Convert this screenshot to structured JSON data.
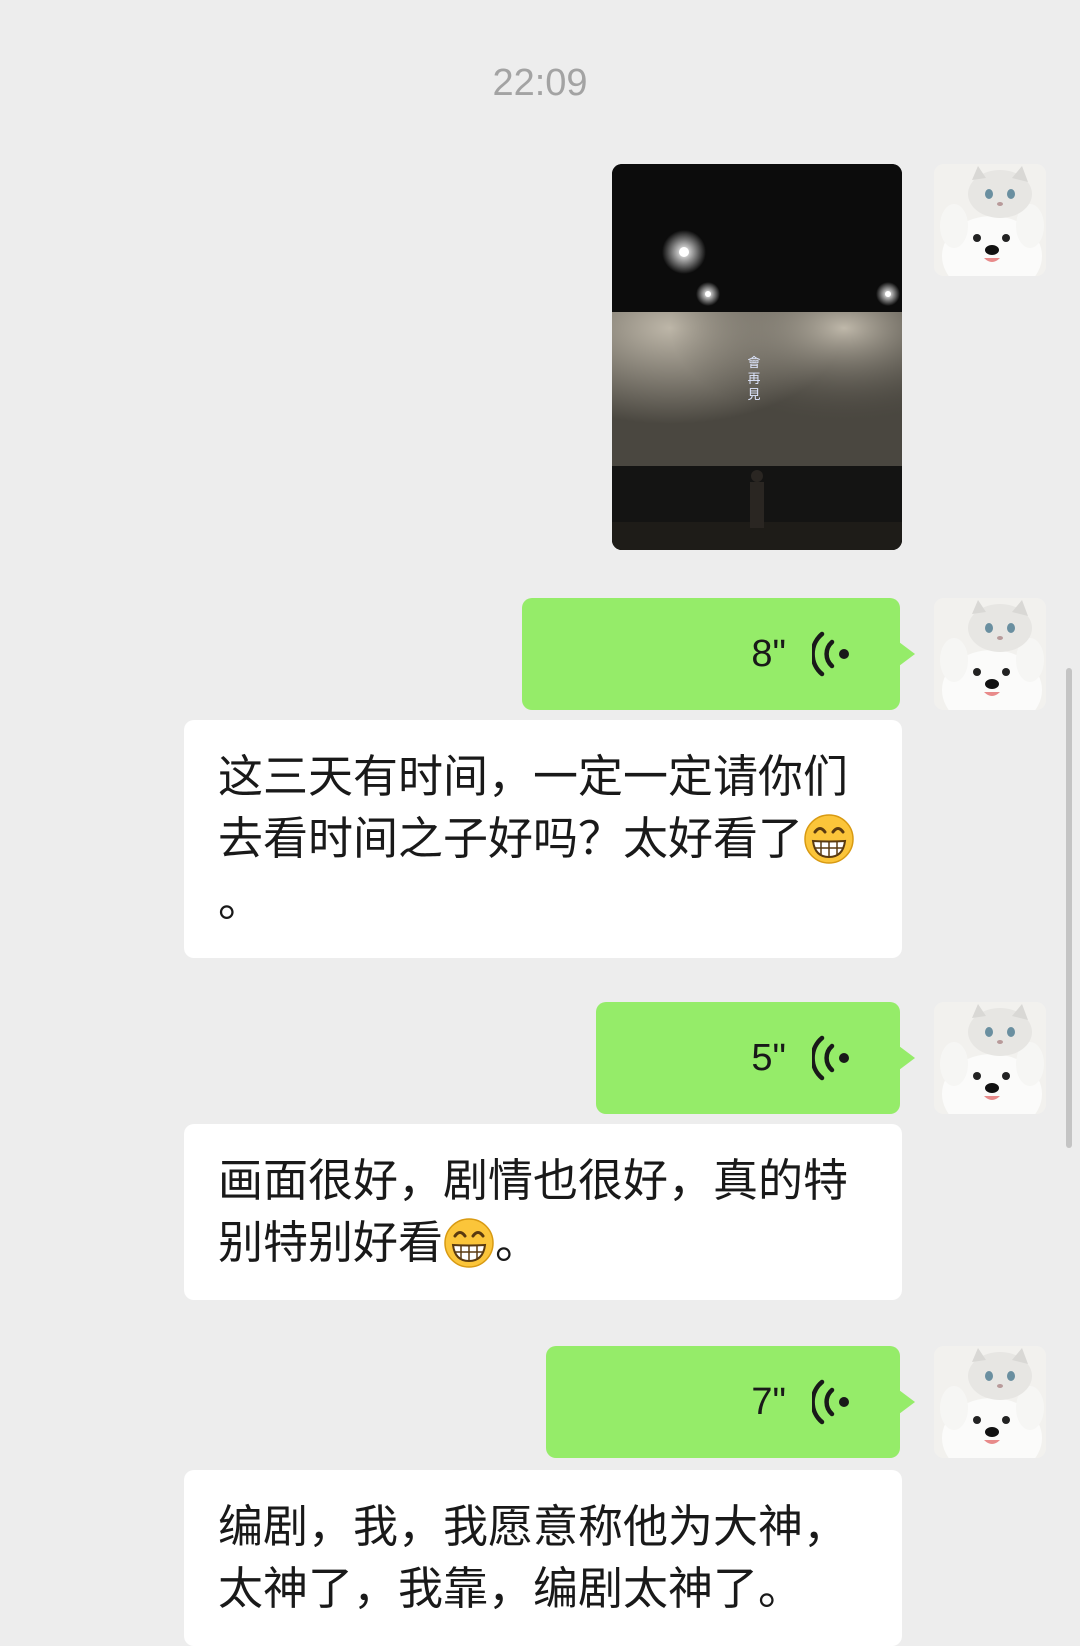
{
  "timestamp": "22:09",
  "colors": {
    "background": "#ededed",
    "self_bubble": "#95ec69",
    "other_bubble": "#ffffff",
    "timestamp_text": "#a3a3a3"
  },
  "photo_message": {
    "screen_text": "會再見",
    "icon": "cinema-photo"
  },
  "messages": [
    {
      "type": "voice",
      "sender": "self",
      "duration": "8\"",
      "icon": "voice-wave-icon"
    },
    {
      "type": "text",
      "sender": "other",
      "parts": [
        "这三天有时间，一定一定请你们去看时间之子好吗？太好看了",
        "。"
      ],
      "emoji": "grinning-face-icon"
    },
    {
      "type": "voice",
      "sender": "self",
      "duration": "5\"",
      "icon": "voice-wave-icon"
    },
    {
      "type": "text",
      "sender": "other",
      "parts": [
        "画面很好，剧情也很好，真的特别特别好看",
        "。"
      ],
      "emoji": "grinning-face-icon"
    },
    {
      "type": "voice",
      "sender": "self",
      "duration": "7\"",
      "icon": "voice-wave-icon"
    },
    {
      "type": "text",
      "sender": "other",
      "parts": [
        "编剧，我，我愿意称他为大神，太神了，我靠，编剧太神了。"
      ]
    }
  ],
  "avatar": {
    "icon": "cat-on-dog-avatar"
  }
}
